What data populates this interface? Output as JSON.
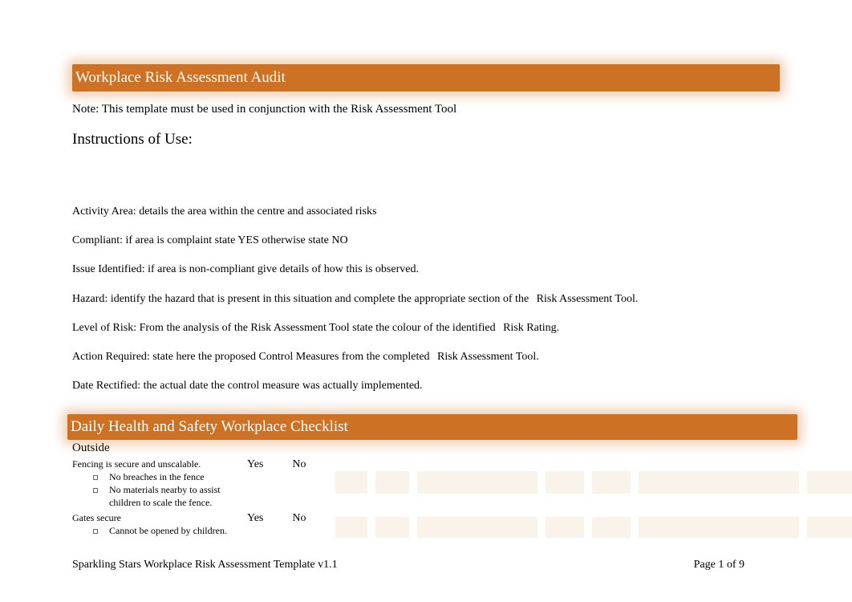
{
  "header": {
    "title": "Workplace Risk Assessment Audit",
    "note": "Note: This template must be used in conjunction with the Risk Assessment Tool",
    "instructions_heading": "Instructions of Use:"
  },
  "definitions": [
    {
      "label": "Activity Area:",
      "text": "details the area within the centre and associated risks"
    },
    {
      "label": "Compliant:",
      "text": "if area is complaint state YES otherwise state NO"
    },
    {
      "label": "Issue Identified:",
      "text": "if area is non-compliant give details of how this is observed."
    },
    {
      "label": "Hazard:",
      "text": "identify the hazard that is present in this situation and complete the appropriate section of the",
      "extra": "Risk Assessment Tool."
    },
    {
      "label": "Level of Risk:",
      "text": "From the analysis of the Risk Assessment Tool state the colour of the identified",
      "extra": "Risk Rating."
    },
    {
      "label": "Action Required:",
      "text": "state here the proposed   Control Measures from the completed",
      "extra": "Risk Assessment Tool."
    },
    {
      "label": "Date Rectified:",
      "text": "the actual date the control measure was actually implemented."
    }
  ],
  "checklist": {
    "title": "Daily Health and Safety Workplace Checklist",
    "section": "Outside",
    "yes": "Yes",
    "no": "No",
    "rows": [
      {
        "title": "Fencing is secure and unscalable.",
        "bullets": [
          "No breaches in the fence",
          "No materials nearby to assist children to scale the fence."
        ]
      },
      {
        "title": "Gates secure",
        "bullets": [
          "Cannot be opened by children."
        ]
      }
    ]
  },
  "footer": {
    "left": "Sparkling Stars Workplace Risk Assessment Template v1.1",
    "right": "Page 1 of 9"
  }
}
